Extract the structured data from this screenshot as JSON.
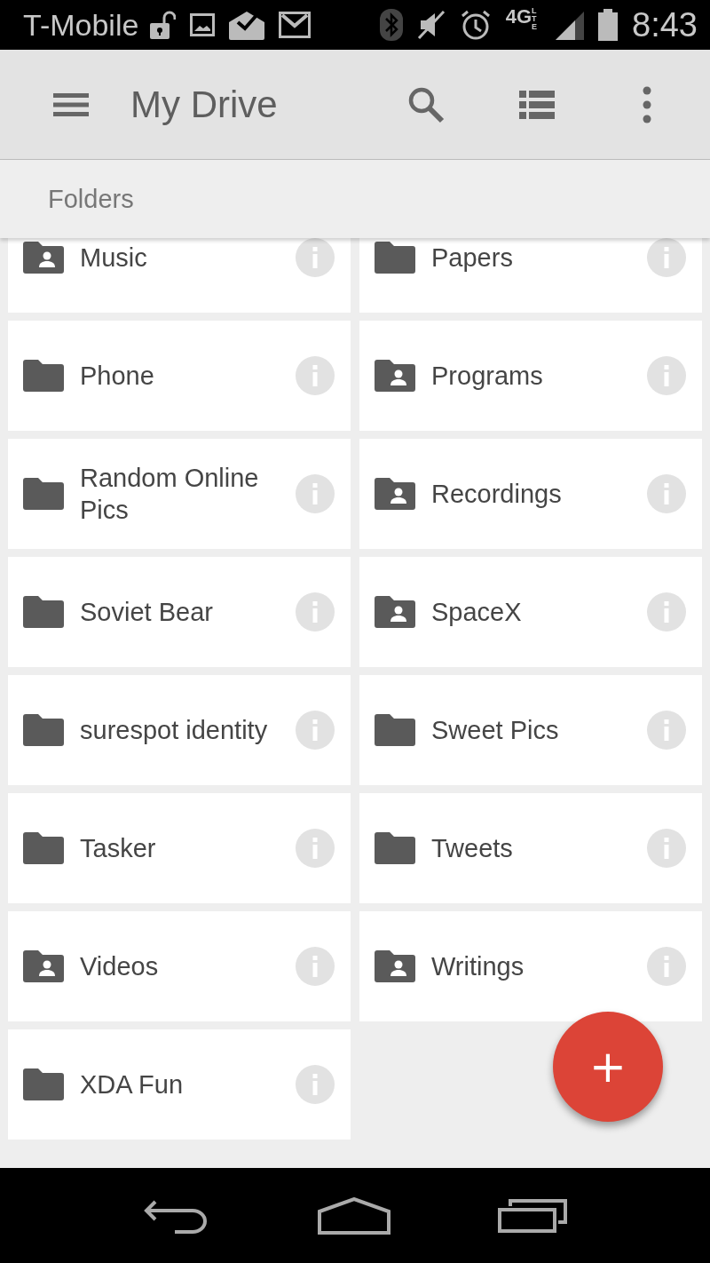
{
  "status_bar": {
    "carrier": "T-Mobile",
    "network": "4G",
    "network_sub": "LTE",
    "time": "8:43"
  },
  "toolbar": {
    "title": "My Drive"
  },
  "section": {
    "title": "Folders"
  },
  "folders": [
    {
      "name": "Music",
      "kind": "shared"
    },
    {
      "name": "Papers",
      "kind": "plain"
    },
    {
      "name": "Phone",
      "kind": "plain"
    },
    {
      "name": "Programs",
      "kind": "shared"
    },
    {
      "name": "Random Online Pics",
      "kind": "plain"
    },
    {
      "name": "Recordings",
      "kind": "shared"
    },
    {
      "name": "Soviet Bear",
      "kind": "plain"
    },
    {
      "name": "SpaceX",
      "kind": "shared"
    },
    {
      "name": "surespot identity",
      "kind": "plain"
    },
    {
      "name": "Sweet Pics",
      "kind": "plain"
    },
    {
      "name": "Tasker",
      "kind": "plain"
    },
    {
      "name": "Tweets",
      "kind": "plain"
    },
    {
      "name": "Videos",
      "kind": "shared"
    },
    {
      "name": "Writings",
      "kind": "shared"
    },
    {
      "name": "XDA Fun",
      "kind": "plain"
    }
  ],
  "fab": {
    "label": "+"
  }
}
